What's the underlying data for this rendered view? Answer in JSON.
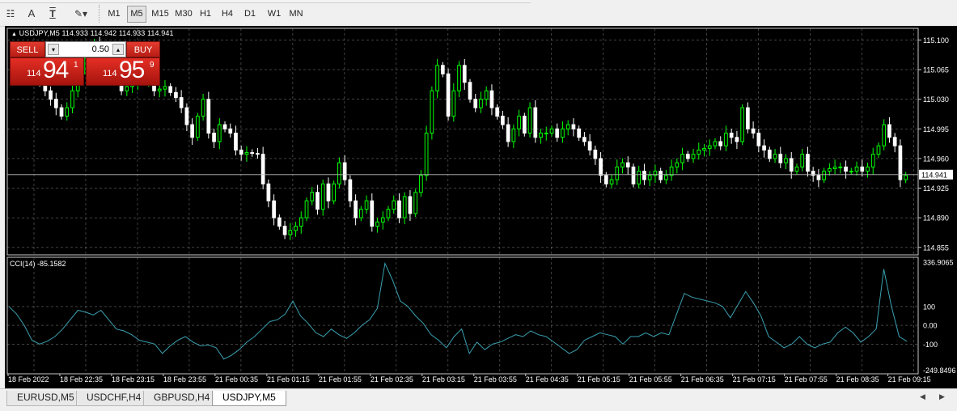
{
  "toolbar": {
    "icons": [
      {
        "name": "bar-chart-icon",
        "glyph": "☷"
      },
      {
        "name": "text-tool-icon",
        "glyph": "A"
      },
      {
        "name": "text-label-icon",
        "glyph": "T"
      },
      {
        "name": "shapes-menu-icon",
        "glyph": "✎▾"
      }
    ],
    "timeframes": [
      "M1",
      "M5",
      "M15",
      "M30",
      "H1",
      "H4",
      "D1",
      "W1",
      "MN"
    ],
    "active_timeframe": "M5"
  },
  "chart_header": {
    "symbol_line": "USDJPY,M5  114.933 114.942 114.933 114.941",
    "marker": "▲"
  },
  "trade_panel": {
    "sell_label": "SELL",
    "buy_label": "BUY",
    "lot_value": "0.50",
    "down_arrow": "▾",
    "up_arrow": "▴",
    "sell_quote": {
      "big": "114",
      "mid": "94",
      "point": "1"
    },
    "buy_quote": {
      "big": "114",
      "mid": "95",
      "point": "9"
    }
  },
  "indicator": {
    "label": "CCI(14) -85.1582"
  },
  "chart_data": {
    "type": "candlestick",
    "colors": {
      "bull": "#00ff00",
      "bear": "#ffffff",
      "grid": "#c0c0c0",
      "text": "#ffffff",
      "bid_line": "#c0c0c0",
      "cci_line": "#3aa0b0",
      "background": "#000000"
    },
    "price_axis": {
      "min": 114.85,
      "max": 115.11,
      "ticks": [
        "115.100",
        "115.065",
        "115.030",
        "114.995",
        "114.960",
        "114.925",
        "114.890",
        "114.855"
      ],
      "current": "114.941"
    },
    "cci_axis": {
      "min": -249.8496,
      "max": 336.9065,
      "ticks": [
        "336.9065",
        "100",
        "0.00",
        "-100",
        "-249.8496"
      ]
    },
    "time_axis": [
      "18 Feb 2022",
      "18 Feb 22:35",
      "18 Feb 23:15",
      "18 Feb 23:55",
      "21 Feb 00:35",
      "21 Feb 01:15",
      "21 Feb 01:55",
      "21 Feb 02:35",
      "21 Feb 03:15",
      "21 Feb 03:55",
      "21 Feb 04:35",
      "21 Feb 05:15",
      "21 Feb 05:55",
      "21 Feb 06:35",
      "21 Feb 07:15",
      "21 Feb 07:55",
      "21 Feb 08:35",
      "21 Feb 09:15"
    ],
    "close": [
      115.06,
      115.05,
      115.04,
      115.03,
      115.02,
      115.01,
      115.02,
      115.04,
      115.06,
      115.08,
      115.09,
      115.095,
      115.09,
      115.08,
      115.07,
      115.06,
      115.04,
      115.045,
      115.05,
      115.06,
      115.05,
      115.055,
      115.04,
      115.042,
      115.045,
      115.038,
      115.032,
      115.02,
      115.0,
      114.985,
      115.01,
      115.03,
      114.99,
      114.98,
      115.0,
      114.995,
      114.99,
      114.97,
      114.965,
      114.967,
      114.966,
      114.965,
      114.93,
      114.91,
      114.89,
      114.88,
      114.87,
      114.875,
      114.88,
      114.89,
      114.91,
      114.92,
      114.9,
      114.93,
      114.91,
      114.93,
      114.955,
      114.935,
      114.91,
      114.89,
      114.9,
      114.91,
      114.88,
      114.885,
      114.89,
      114.9,
      114.91,
      114.89,
      114.915,
      114.895,
      114.92,
      114.94,
      114.99,
      115.04,
      115.07,
      115.06,
      115.01,
      115.04,
      115.07,
      115.05,
      115.03,
      115.02,
      115.03,
      115.04,
      115.02,
      115.01,
      115.0,
      114.98,
      114.995,
      115.01,
      114.99,
      115.02,
      114.985,
      114.99,
      114.99,
      114.995,
      114.985,
      114.995,
      115.0,
      114.995,
      114.985,
      114.98,
      114.97,
      114.96,
      114.94,
      114.93,
      114.935,
      114.95,
      114.955,
      114.95,
      114.93,
      114.945,
      114.935,
      114.94,
      114.945,
      114.935,
      114.94,
      114.95,
      114.955,
      114.965,
      114.96,
      114.965,
      114.97,
      114.972,
      114.975,
      114.98,
      114.975,
      114.99,
      114.985,
      114.98,
      115.02,
      114.995,
      114.99,
      114.975,
      114.97,
      114.96,
      114.965,
      114.955,
      114.96,
      114.945,
      114.95,
      114.965,
      114.945,
      114.94,
      114.935,
      114.945,
      114.948,
      114.95,
      114.95,
      114.945,
      114.945,
      114.95,
      114.945,
      114.95,
      114.965,
      114.975,
      115.0,
      114.985,
      114.975,
      114.935,
      114.94
    ],
    "cci": [
      100,
      60,
      0,
      -80,
      -100,
      -85,
      -60,
      -20,
      30,
      80,
      70,
      55,
      80,
      30,
      -20,
      -30,
      -50,
      -80,
      -90,
      -100,
      -150,
      -110,
      -80,
      -60,
      -90,
      -110,
      -105,
      -120,
      -180,
      -160,
      -130,
      -90,
      -60,
      -20,
      20,
      30,
      60,
      130,
      50,
      10,
      -40,
      -60,
      -20,
      -50,
      -70,
      -40,
      0,
      30,
      90,
      330,
      240,
      130,
      100,
      50,
      10,
      -50,
      -80,
      -120,
      -60,
      -20,
      -150,
      -90,
      -130,
      -100,
      -90,
      -70,
      -50,
      -60,
      -30,
      -50,
      -60,
      -90,
      -120,
      -150,
      -130,
      -80,
      -60,
      -40,
      -50,
      -60,
      -100,
      -60,
      -60,
      -40,
      -60,
      -40,
      -50,
      60,
      170,
      150,
      140,
      130,
      120,
      100,
      40,
      110,
      180,
      120,
      50,
      -60,
      -90,
      -120,
      -100,
      -60,
      -100,
      -120,
      -100,
      -90,
      -40,
      -10,
      -40,
      -90,
      -60,
      -20,
      300,
      100,
      -60,
      -85
    ]
  },
  "tabs": [
    {
      "label": "EURUSD,M5",
      "active": false
    },
    {
      "label": "USDCHF,H4",
      "active": false
    },
    {
      "label": "GBPUSD,H4",
      "active": false
    },
    {
      "label": "USDJPY,M5",
      "active": true
    }
  ],
  "scroll": {
    "left": "◀",
    "right": "▶"
  }
}
